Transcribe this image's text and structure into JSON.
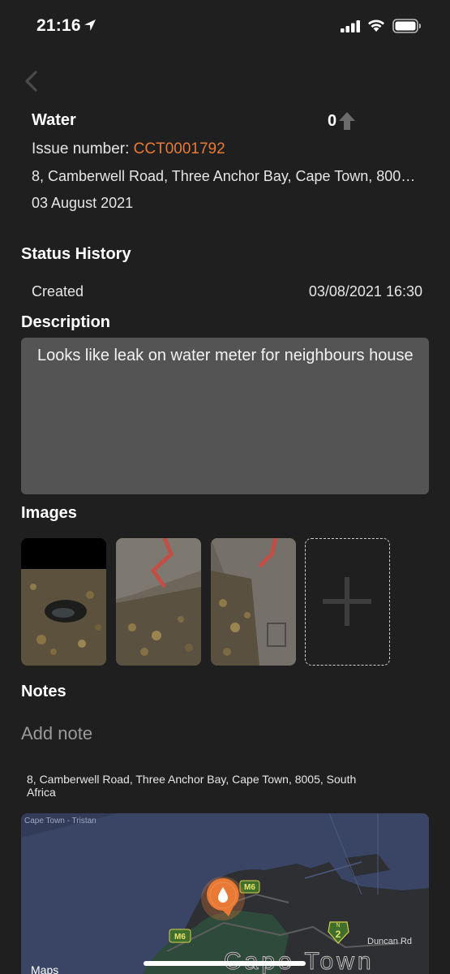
{
  "status_bar": {
    "time": "21:16"
  },
  "issue": {
    "category": "Water",
    "votes": "0",
    "issue_label": "Issue number: ",
    "issue_number": "CCT0001792",
    "address": "8, Camberwell Road, Three Anchor Bay, Cape Town, 8005, South Africa",
    "date": "03 August 2021"
  },
  "status_history": {
    "heading": "Status History",
    "entries": [
      {
        "status": "Created",
        "timestamp": "03/08/2021 16:30"
      }
    ]
  },
  "description": {
    "heading": "Description",
    "text": "Looks like leak on water meter for neighbours house"
  },
  "images": {
    "heading": "Images",
    "count": 3
  },
  "notes": {
    "heading": "Notes",
    "add_note": "Add note"
  },
  "map": {
    "address": "8, Camberwell Road, Three Anchor Bay, Cape Town, 8005, South Africa",
    "road_label": "Cape Town - Tristan",
    "shield_m6": "M6",
    "shield_n2": "2",
    "shield_n2_prefix": "N",
    "street_label": "Duncan Rd",
    "city_label": "Cape Town",
    "attribution": "Maps"
  },
  "colors": {
    "accent": "#e87a35",
    "background": "#1f1f1f",
    "field": "#545454"
  },
  "icons": {
    "back": "chevron-left-icon",
    "upvote": "arrow-up-icon",
    "add_image": "plus-icon",
    "map_pin": "water-drop-pin-icon"
  }
}
